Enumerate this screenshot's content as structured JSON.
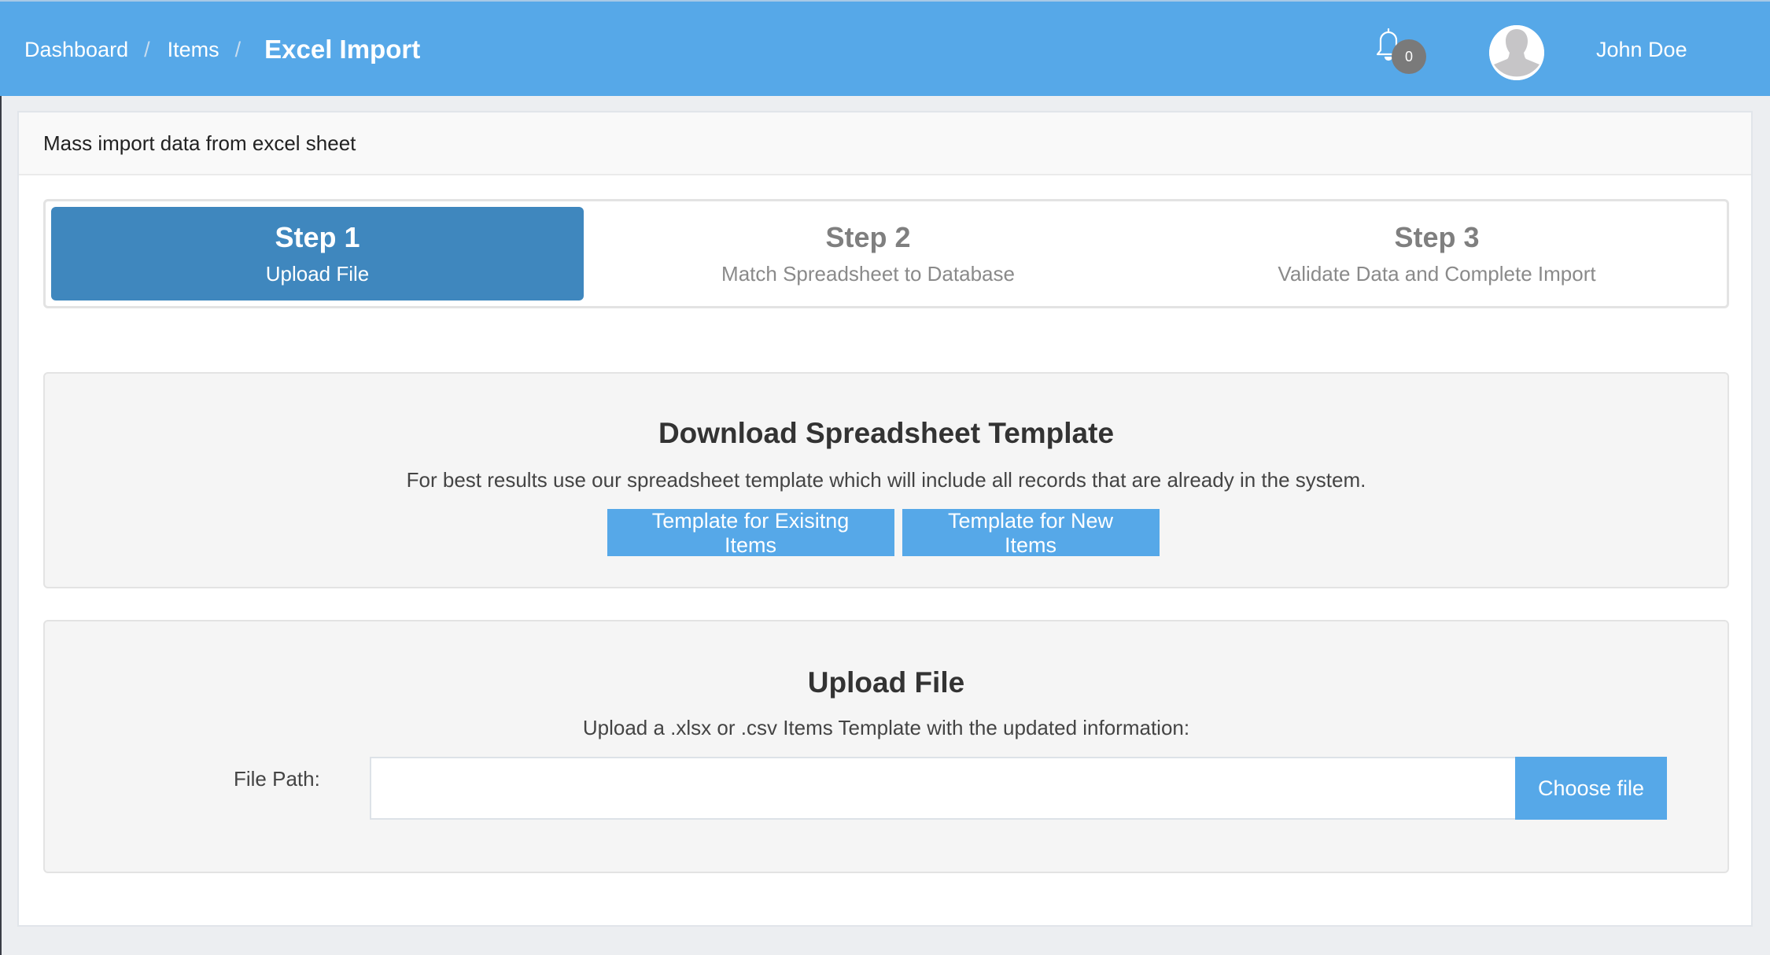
{
  "header": {
    "breadcrumb": [
      {
        "label": "Dashboard"
      },
      {
        "label": "Items"
      }
    ],
    "separator": "/",
    "current_page": "Excel Import",
    "notifications": {
      "icon": "bell-icon",
      "count": "0"
    },
    "user": {
      "name": "John Doe",
      "avatar_icon": "user-silhouette-icon"
    }
  },
  "card": {
    "title": "Mass import data from excel sheet"
  },
  "steps": [
    {
      "title": "Step 1",
      "subtitle": "Upload File",
      "active": true
    },
    {
      "title": "Step 2",
      "subtitle": "Match Spreadsheet to Database",
      "active": false
    },
    {
      "title": "Step 3",
      "subtitle": "Validate Data and Complete Import",
      "active": false
    }
  ],
  "download_section": {
    "title": "Download Spreadsheet Template",
    "description": "For best results use our spreadsheet template which will include all records that are already in the system.",
    "buttons": [
      {
        "label": "Template for Exisitng Items"
      },
      {
        "label": "Template for New Items"
      }
    ]
  },
  "upload_section": {
    "title": "Upload File",
    "description": "Upload a .xlsx or .csv Items Template with the updated information:",
    "file_path_label": "File Path:",
    "file_path_value": "",
    "choose_button_label": "Choose file"
  },
  "colors": {
    "header_bg": "#56A8E8",
    "active_step_bg": "#3F87BE",
    "button_bg": "#56A8E8",
    "page_bg": "#ECEEF1"
  }
}
